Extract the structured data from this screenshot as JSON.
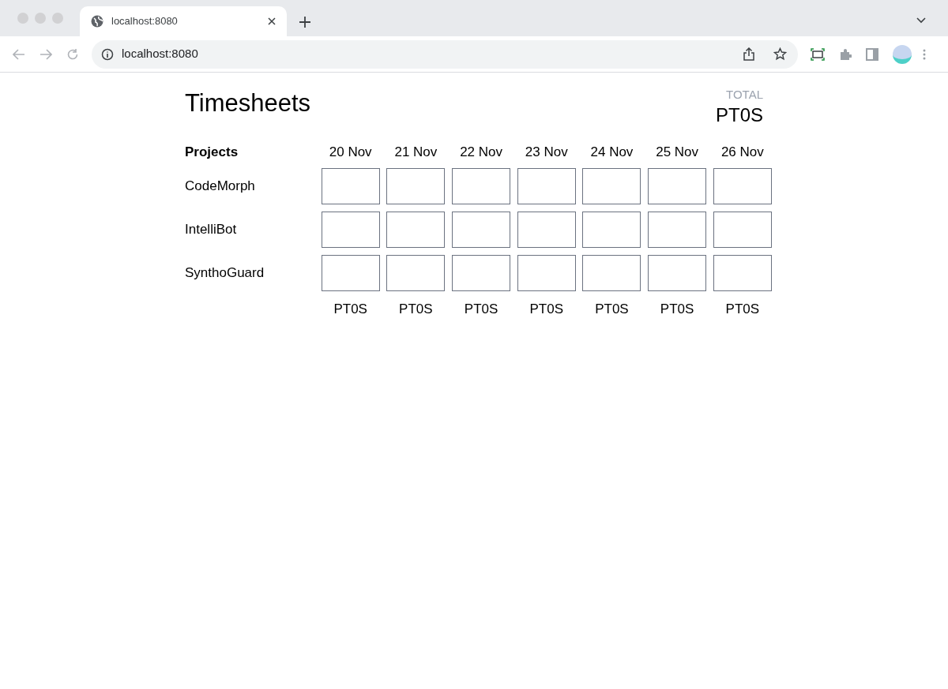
{
  "browser": {
    "tab_title": "localhost:8080",
    "address": "localhost:8080"
  },
  "page": {
    "title": "Timesheets",
    "total": {
      "label": "TOTAL",
      "value": "PT0S"
    },
    "projects_heading": "Projects",
    "dates": [
      "20 Nov",
      "21 Nov",
      "22 Nov",
      "23 Nov",
      "24 Nov",
      "25 Nov",
      "26 Nov"
    ],
    "rows": [
      {
        "project": "CodeMorph"
      },
      {
        "project": "IntelliBot"
      },
      {
        "project": "SynthoGuard"
      }
    ],
    "column_totals": [
      "PT0S",
      "PT0S",
      "PT0S",
      "PT0S",
      "PT0S",
      "PT0S",
      "PT0S"
    ]
  }
}
